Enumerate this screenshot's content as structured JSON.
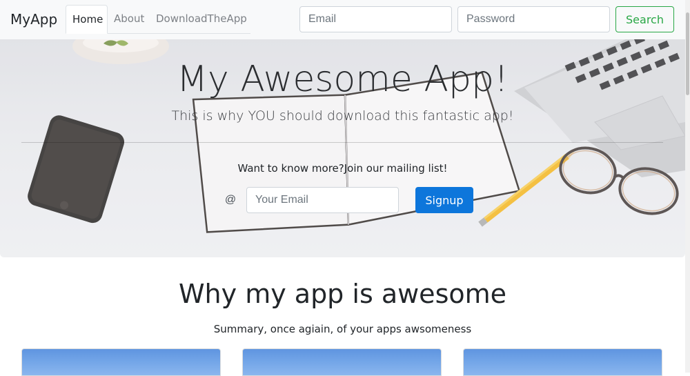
{
  "navbar": {
    "brand": "MyApp",
    "tabs": [
      {
        "label": "Home",
        "active": true
      },
      {
        "label": "About",
        "active": false
      },
      {
        "label": "DownloadTheApp",
        "active": false
      }
    ],
    "email_placeholder": "Email",
    "password_placeholder": "Password",
    "search_label": "Search"
  },
  "hero": {
    "title": "My Awesome App!",
    "subtitle": "This is why YOU should download this fantastic app!",
    "mailing_text": "Want to know more?Join our mailing list!",
    "at_symbol": "@",
    "email_placeholder": "Your Email",
    "signup_label": "Signup"
  },
  "features": {
    "title": "Why my app is awesome",
    "summary": "Summary, once agiain, of your apps awsomeness"
  },
  "colors": {
    "navbar_bg": "#f8f9fa",
    "success": "#28a745",
    "primary": "#0d76db"
  }
}
